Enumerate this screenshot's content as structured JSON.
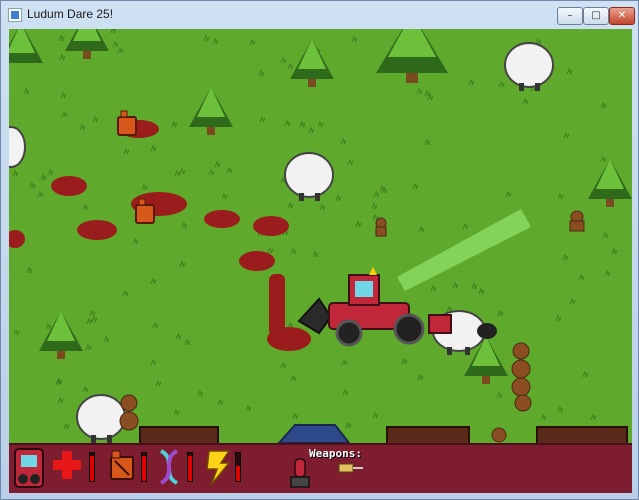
{
  "window": {
    "title": "Ludum Dare 25!",
    "controls": {
      "minimize_glyph": "–",
      "maximize_glyph": "□",
      "close_glyph": "✕"
    }
  },
  "colors": {
    "grass": "#5faa2c",
    "grass_tuft": "#3f7f1e",
    "blood": "#9b1c1c",
    "tree_dark": "#2e6a1a",
    "tree_light": "#6cc03a",
    "trunk": "#7a4a20",
    "sheep": "#f2f2f2",
    "hud_bg": "#7d1d2f",
    "health_bar": "#e00000",
    "laser": "#8fe06a"
  },
  "hud": {
    "player_icon": "tractor-portrait-icon",
    "stats": [
      {
        "icon": "red-cross-health-icon",
        "level": 0.9
      },
      {
        "icon": "fuel-can-icon",
        "level": 0.9
      },
      {
        "icon": "dna-helix-icon",
        "level": 0.9
      },
      {
        "icon": "lightning-bolt-icon",
        "level": 0.55
      }
    ],
    "weapons_label": "Weapons:",
    "weapons": [
      {
        "icon": "missile-launcher-icon",
        "selected": true
      },
      {
        "icon": "syringe-gun-icon",
        "selected": false
      }
    ]
  }
}
